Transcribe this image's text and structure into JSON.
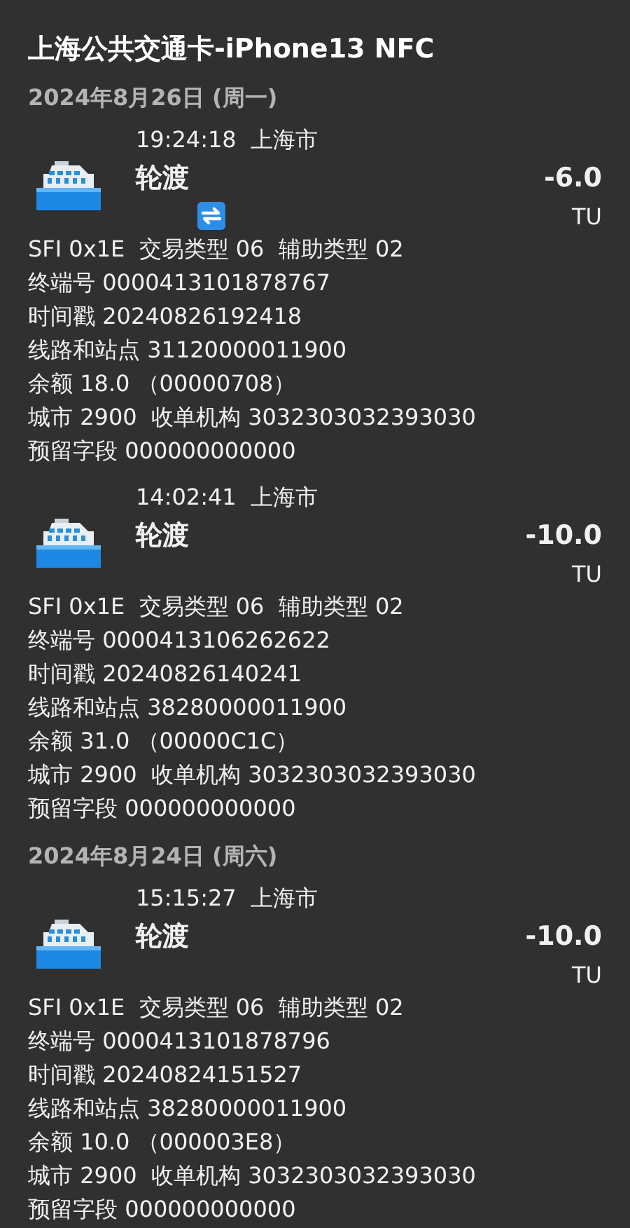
{
  "title": "上海公共交通卡-iPhone13 NFC",
  "days": [
    {
      "date": "2024年8月26日 (周一)",
      "records": [
        {
          "time": "19:24:18",
          "city": "上海市",
          "name": "轮渡",
          "amount": "-6.0",
          "unit": "TU",
          "transfer": true,
          "details": [
            "SFI 0x1E  交易类型 06  辅助类型 02",
            "终端号 0000413101878767",
            "时间戳 20240826192418",
            "线路和站点 31120000011900",
            "余额 18.0 （00000708）",
            "城市 2900  收单机构 3032303032393030",
            "预留字段 000000000000"
          ]
        },
        {
          "time": "14:02:41",
          "city": "上海市",
          "name": "轮渡",
          "amount": "-10.0",
          "unit": "TU",
          "transfer": false,
          "details": [
            "SFI 0x1E  交易类型 06  辅助类型 02",
            "终端号 0000413106262622",
            "时间戳 20240826140241",
            "线路和站点 38280000011900",
            "余额 31.0 （00000C1C）",
            "城市 2900  收单机构 3032303032393030",
            "预留字段 000000000000"
          ]
        }
      ]
    },
    {
      "date": "2024年8月24日 (周六)",
      "records": [
        {
          "time": "15:15:27",
          "city": "上海市",
          "name": "轮渡",
          "amount": "-10.0",
          "unit": "TU",
          "transfer": false,
          "details": [
            "SFI 0x1E  交易类型 06  辅助类型 02",
            "终端号 0000413101878796",
            "时间戳 20240824151527",
            "线路和站点 38280000011900",
            "余额 10.0 （000003E8）",
            "城市 2900  收单机构 3032303032393030",
            "预留字段 000000000000"
          ]
        }
      ]
    }
  ]
}
